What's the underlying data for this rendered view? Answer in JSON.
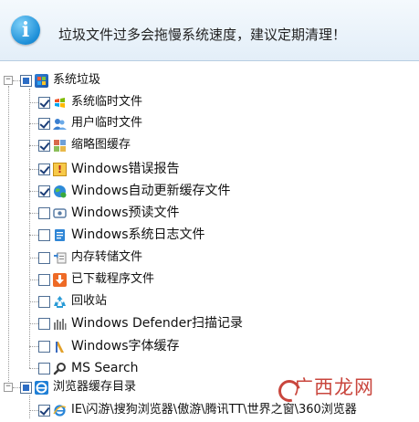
{
  "banner": {
    "icon": "info-icon",
    "text": "垃圾文件过多会拖慢系统速度，建议定期清理！"
  },
  "tree": {
    "groups": [
      {
        "label": "系统垃圾",
        "state": "partial",
        "expanded": true,
        "icon": "windows-logo-icon",
        "items": [
          {
            "label": "系统临时文件",
            "checked": true,
            "icon": "windows-flag-icon"
          },
          {
            "label": "用户临时文件",
            "checked": true,
            "icon": "user-icon"
          },
          {
            "label": "缩略图缓存",
            "checked": true,
            "icon": "thumbnail-icon"
          },
          {
            "label": "Windows错误报告",
            "checked": true,
            "icon": "warning-icon"
          },
          {
            "label": "Windows自动更新缓存文件",
            "checked": true,
            "icon": "update-globe-icon"
          },
          {
            "label": "Windows预读文件",
            "checked": false,
            "icon": "prefetch-icon"
          },
          {
            "label": "Windows系统日志文件",
            "checked": false,
            "icon": "log-icon"
          },
          {
            "label": "内存转储文件",
            "checked": false,
            "icon": "memory-dump-icon"
          },
          {
            "label": "已下载程序文件",
            "checked": false,
            "icon": "download-icon"
          },
          {
            "label": "回收站",
            "checked": false,
            "icon": "recycle-bin-icon"
          },
          {
            "label": "Windows Defender扫描记录",
            "checked": false,
            "icon": "defender-icon"
          },
          {
            "label": "Windows字体缓存",
            "checked": false,
            "icon": "font-icon"
          },
          {
            "label": "MS Search",
            "checked": false,
            "icon": "search-icon"
          }
        ]
      },
      {
        "label": "浏览器缓存目录",
        "state": "partial",
        "expanded": true,
        "icon": "ie-browser-icon",
        "items": [
          {
            "label": "IE\\闪游\\搜狗浏览器\\傲游\\腾讯TT\\世界之窗\\360浏览器",
            "checked": true,
            "icon": "ie-browser-icon"
          }
        ]
      }
    ]
  },
  "watermark": {
    "text": "广西龙网"
  },
  "colors": {
    "checkbox_border": "#4f6f95",
    "checkmark": "#1c3e78",
    "banner_bg": "#e3eef8",
    "watermark": "#c9463d"
  }
}
